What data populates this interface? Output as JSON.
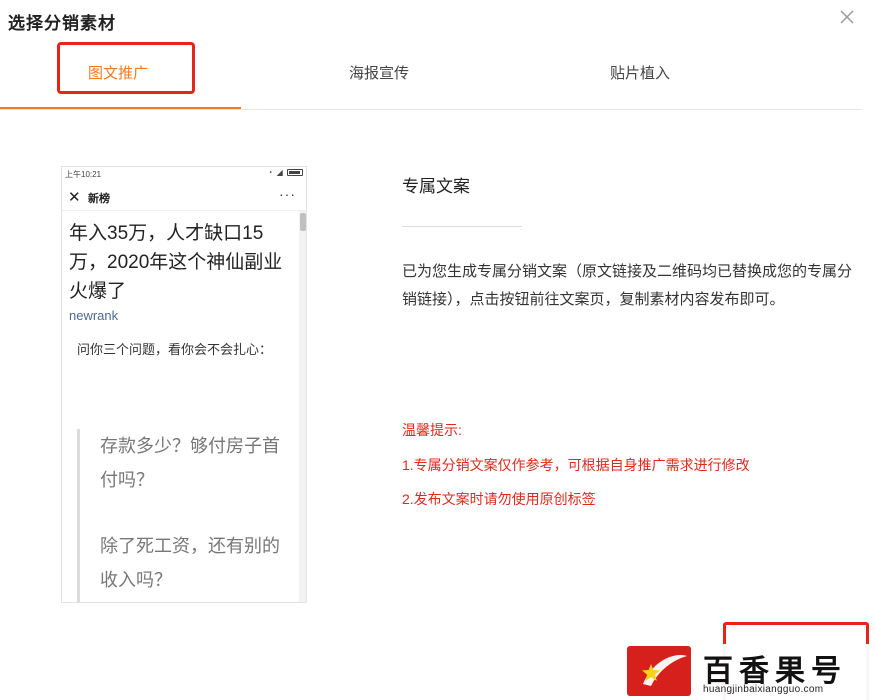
{
  "dialog": {
    "title": "选择分销素材"
  },
  "tabs": [
    {
      "label": "图文推广",
      "active": true
    },
    {
      "label": "海报宣传",
      "active": false
    },
    {
      "label": "贴片植入",
      "active": false
    }
  ],
  "preview": {
    "status_time": "上午10:21",
    "nav_close": "✕",
    "nav_title": "新榜",
    "nav_more": "···",
    "article_title": "年入35万，人才缺口15万，2020年这个神仙副业火爆了",
    "article_source": "newrank",
    "intro": "问你三个问题，看你会不会扎心：",
    "quotes": [
      "存款多少？够付房子首付吗？",
      "除了死工资，还有别的收入吗？"
    ]
  },
  "content": {
    "section_title": "专属文案",
    "description": "已为您生成专属分销文案（原文链接及二维码均已替换成您的专属分销链接），点击按钮前往文案页，复制素材内容发布即可。",
    "tips_title": "温馨提示:",
    "tips": [
      "1.专属分销文案仅作参考，可根据自身推广需求进行修改",
      "2.发布文案时请勿使用原创标签"
    ]
  },
  "watermark": {
    "text": "百香果号",
    "url": "huangjinbaixiangguo.com"
  },
  "colors": {
    "accent": "#f07a22",
    "warning": "#e0281e",
    "highlight": "#e8231a"
  }
}
